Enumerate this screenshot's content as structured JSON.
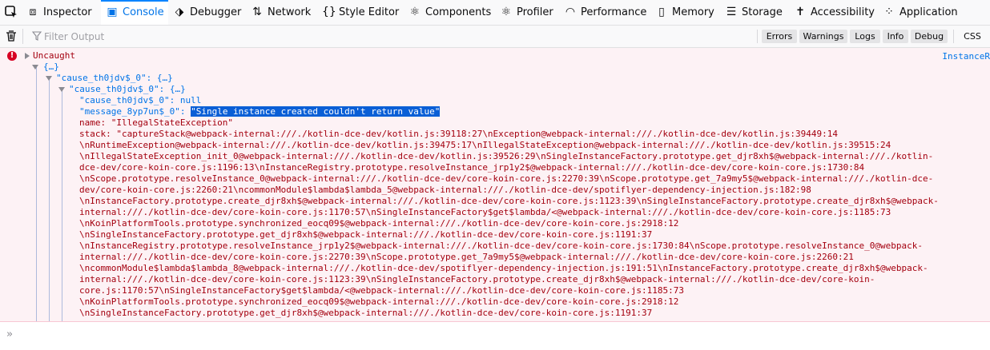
{
  "toolbar": {
    "tabs": [
      {
        "label": "Inspector",
        "icon": "inspector-icon"
      },
      {
        "label": "Console",
        "icon": "console-icon"
      },
      {
        "label": "Debugger",
        "icon": "debugger-icon"
      },
      {
        "label": "Network",
        "icon": "network-icon"
      },
      {
        "label": "Style Editor",
        "icon": "style-editor-icon"
      },
      {
        "label": "Components",
        "icon": "components-icon"
      },
      {
        "label": "Profiler",
        "icon": "profiler-icon"
      },
      {
        "label": "Performance",
        "icon": "performance-icon"
      },
      {
        "label": "Memory",
        "icon": "memory-icon"
      },
      {
        "label": "Storage",
        "icon": "storage-icon"
      },
      {
        "label": "Accessibility",
        "icon": "accessibility-icon"
      },
      {
        "label": "Application",
        "icon": "application-icon"
      }
    ],
    "selected": "Console"
  },
  "filter": {
    "placeholder": "Filter Output",
    "buttons": [
      "Errors",
      "Warnings",
      "Logs",
      "Info",
      "Debug"
    ],
    "css_label": "CSS"
  },
  "message": {
    "label": "Uncaught",
    "source": "InstanceR",
    "lines": [
      "{…}",
      "\"cause_th0jdv$_0\": {…}",
      "\"cause_th0jdv$_0\": {…}",
      "\"cause_th0jdv$_0\": null",
      "\"message_8yp7un$_0\": ",
      "\"Single instance created couldn't return value\"",
      "name: \"IllegalStateException\"",
      "stack: \"captureStack@webpack-internal:///./kotlin-dce-dev/kotlin.js:39118:27\\nException@webpack-internal:///./kotlin-dce-dev/kotlin.js:39449:14",
      "\\nRuntimeException@webpack-internal:///./kotlin-dce-dev/kotlin.js:39475:17\\nIllegalStateException@webpack-internal:///./kotlin-dce-dev/kotlin.js:39515:24",
      "\\nIllegalStateException_init_0@webpack-internal:///./kotlin-dce-dev/kotlin.js:39526:29\\nSingleInstanceFactory.prototype.get_djr8xh$@webpack-internal:///./kotlin-",
      "dce-dev/core-koin-core.js:1196:13\\nInstanceRegistry.prototype.resolveInstance_jrp1y2$@webpack-internal:///./kotlin-dce-dev/core-koin-core.js:1730:84",
      "\\nScope.prototype.resolveInstance_0@webpack-internal:///./kotlin-dce-dev/core-koin-core.js:2270:39\\nScope.prototype.get_7a9my5$@webpack-internal:///./kotlin-dce-",
      "dev/core-koin-core.js:2260:21\\ncommonModule$lambda$lambda_5@webpack-internal:///./kotlin-dce-dev/spotiflyer-dependency-injection.js:182:98",
      "\\nInstanceFactory.prototype.create_djr8xh$@webpack-internal:///./kotlin-dce-dev/core-koin-core.js:1123:39\\nSingleInstanceFactory.prototype.create_djr8xh$@webpack-",
      "internal:///./kotlin-dce-dev/core-koin-core.js:1170:57\\nSingleInstanceFactory$get$lambda/<@webpack-internal:///./kotlin-dce-dev/core-koin-core.js:1185:73",
      "\\nKoinPlatformTools.prototype.synchronized_eocq09$@webpack-internal:///./kotlin-dce-dev/core-koin-core.js:2918:12",
      "\\nSingleInstanceFactory.prototype.get_djr8xh$@webpack-internal:///./kotlin-dce-dev/core-koin-core.js:1191:37",
      "\\nInstanceRegistry.prototype.resolveInstance_jrp1y2$@webpack-internal:///./kotlin-dce-dev/core-koin-core.js:1730:84\\nScope.prototype.resolveInstance_0@webpack-",
      "internal:///./kotlin-dce-dev/core-koin-core.js:2270:39\\nScope.prototype.get_7a9my5$@webpack-internal:///./kotlin-dce-dev/core-koin-core.js:2260:21",
      "\\ncommonModule$lambda$lambda_8@webpack-internal:///./kotlin-dce-dev/spotiflyer-dependency-injection.js:191:51\\nInstanceFactory.prototype.create_djr8xh$@webpack-",
      "internal:///./kotlin-dce-dev/core-koin-core.js:1123:39\\nSingleInstanceFactory.prototype.create_djr8xh$@webpack-internal:///./kotlin-dce-dev/core-koin-",
      "core.js:1170:57\\nSingleInstanceFactory$get$lambda/<@webpack-internal:///./kotlin-dce-dev/core-koin-core.js:1185:73",
      "\\nKoinPlatformTools.prototype.synchronized_eocq09$@webpack-internal:///./kotlin-dce-dev/core-koin-core.js:2918:12",
      "\\nSingleInstanceFactory.prototype.get_djr8xh$@webpack-internal:///./kotlin-dce-dev/core-koin-core.js:1191:37"
    ]
  },
  "prompt": {
    "chevron": "»"
  },
  "colors": {
    "error": "#a4000f",
    "link": "#0074e8",
    "accent": "#0a84ff",
    "error_bg": "#fdf2f5"
  }
}
